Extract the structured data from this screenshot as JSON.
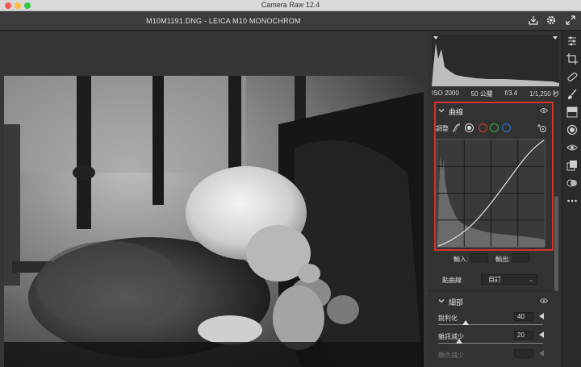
{
  "window": {
    "title": "Camera Raw 12.4"
  },
  "header": {
    "file_title": "M10M1191.DNG  -  LEICA M10 MONOCHROM"
  },
  "exif": {
    "iso": "ISO 2000",
    "focal": "50 公釐",
    "aperture": "f/3.4",
    "shutter": "1/1,250 秒"
  },
  "curve_panel": {
    "title": "曲線",
    "adjust_label": "調整",
    "input_label": "輸入:",
    "output_label": "輸出:",
    "point_curve_label": "點曲線",
    "point_curve_value": "自訂",
    "channel_colors": {
      "white": "#d8d8d8",
      "red": "#d43a2f",
      "green": "#35b24a",
      "blue": "#2f7be0"
    },
    "highlight_color": "#d4322a"
  },
  "detail_panel": {
    "title": "細部",
    "sharpening": {
      "label": "銳利化",
      "value": "40"
    },
    "noise_reduction": {
      "label": "雜訊減少",
      "value": "20"
    },
    "color_noise_reduction": {
      "label": "顏色減少"
    }
  }
}
